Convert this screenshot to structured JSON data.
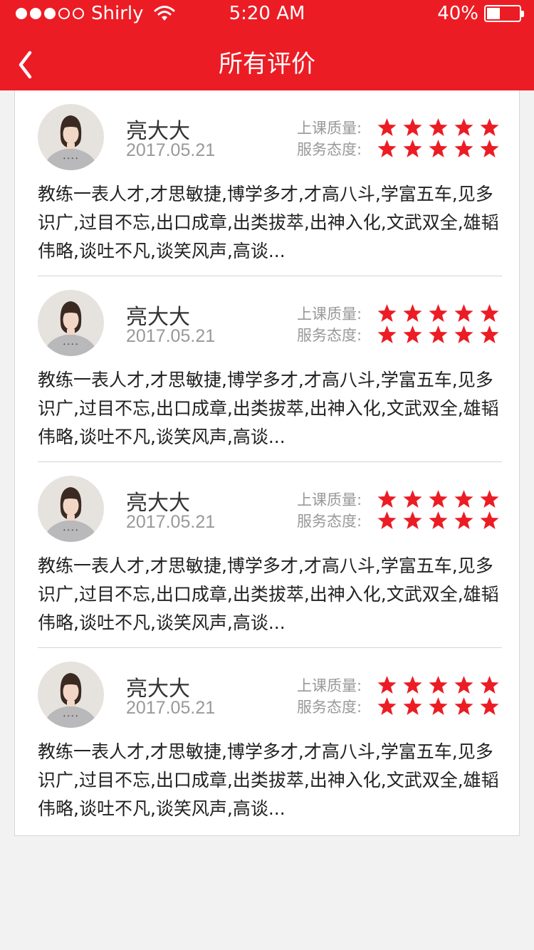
{
  "status_bar": {
    "carrier": "Shirly",
    "time": "5:20 AM",
    "battery_percent": "40%",
    "signal_bars_filled": 3,
    "signal_bars_total": 5,
    "battery_level": 0.4
  },
  "nav": {
    "title": "所有评价",
    "back_icon": "chevron-left-icon"
  },
  "rating_labels": {
    "quality": "上课质量:",
    "attitude": "服务态度:"
  },
  "reviews": [
    {
      "name": "亮大大",
      "date": "2017.05.21",
      "quality_stars": 5,
      "attitude_stars": 5,
      "comment": "教练一表人才,才思敏捷,博学多才,才高八斗,学富五车,见多识广,过目不忘,出口成章,出类拔萃,出神入化,文武双全,雄韬伟略,谈吐不凡,谈笑风声,高谈..."
    },
    {
      "name": "亮大大",
      "date": "2017.05.21",
      "quality_stars": 5,
      "attitude_stars": 5,
      "comment": "教练一表人才,才思敏捷,博学多才,才高八斗,学富五车,见多识广,过目不忘,出口成章,出类拔萃,出神入化,文武双全,雄韬伟略,谈吐不凡,谈笑风声,高谈..."
    },
    {
      "name": "亮大大",
      "date": "2017.05.21",
      "quality_stars": 5,
      "attitude_stars": 5,
      "comment": "教练一表人才,才思敏捷,博学多才,才高八斗,学富五车,见多识广,过目不忘,出口成章,出类拔萃,出神入化,文武双全,雄韬伟略,谈吐不凡,谈笑风声,高谈..."
    },
    {
      "name": "亮大大",
      "date": "2017.05.21",
      "quality_stars": 5,
      "attitude_stars": 5,
      "comment": "教练一表人才,才思敏捷,博学多才,才高八斗,学富五车,见多识广,过目不忘,出口成章,出类拔萃,出神入化,文武双全,雄韬伟略,谈吐不凡,谈笑风声,高谈..."
    }
  ],
  "colors": {
    "brand_red": "#ec1c24",
    "star_red": "#ec1c24",
    "label_gray": "#999999",
    "text_dark": "#222222"
  }
}
